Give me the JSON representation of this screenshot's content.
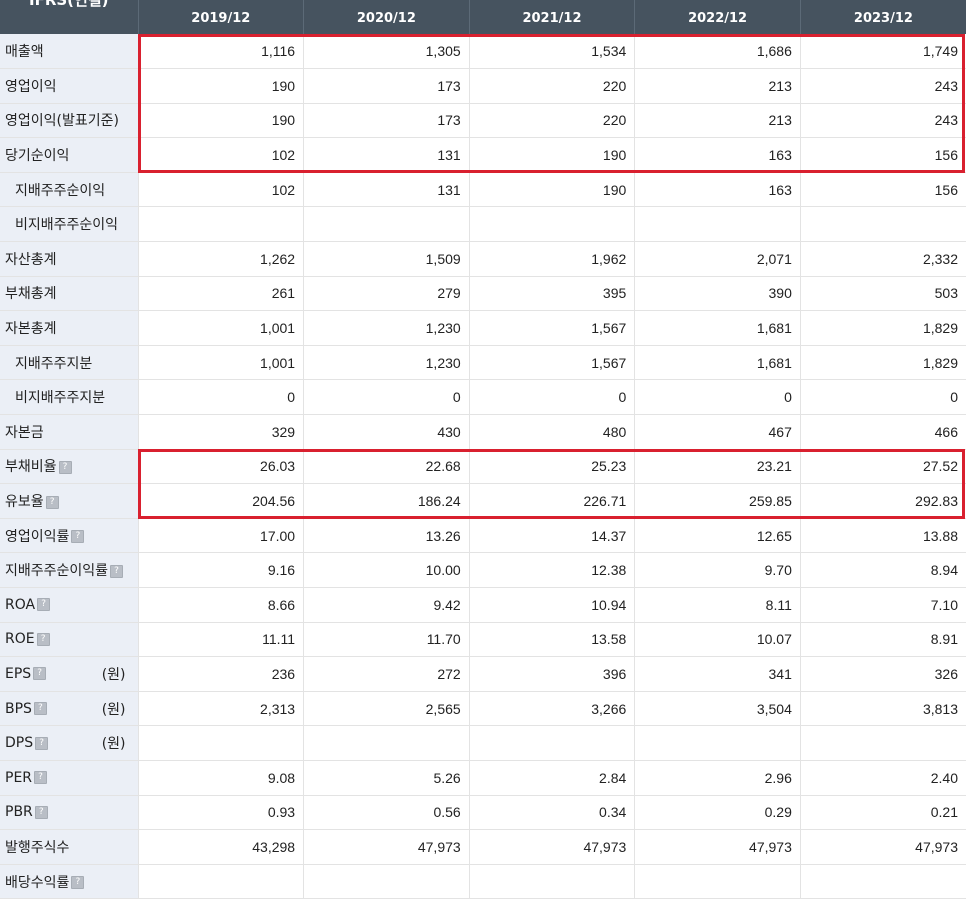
{
  "table": {
    "corner_label": "IFRS(연결)",
    "columns": [
      "2019/12",
      "2020/12",
      "2021/12",
      "2022/12",
      "2023/12"
    ],
    "rows": [
      {
        "label": "매출액",
        "values": [
          "1,116",
          "1,305",
          "1,534",
          "1,686",
          "1,749"
        ]
      },
      {
        "label": "영업이익",
        "values": [
          "190",
          "173",
          "220",
          "213",
          "243"
        ]
      },
      {
        "label": "영업이익(발표기준)",
        "values": [
          "190",
          "173",
          "220",
          "213",
          "243"
        ]
      },
      {
        "label": "당기순이익",
        "values": [
          "102",
          "131",
          "190",
          "163",
          "156"
        ]
      },
      {
        "label": "지배주주순이익",
        "sub": true,
        "values": [
          "102",
          "131",
          "190",
          "163",
          "156"
        ]
      },
      {
        "label": "비지배주주순이익",
        "sub": true,
        "values": [
          "",
          "",
          "",
          "",
          ""
        ]
      },
      {
        "label": "자산총계",
        "values": [
          "1,262",
          "1,509",
          "1,962",
          "2,071",
          "2,332"
        ]
      },
      {
        "label": "부채총계",
        "values": [
          "261",
          "279",
          "395",
          "390",
          "503"
        ]
      },
      {
        "label": "자본총계",
        "values": [
          "1,001",
          "1,230",
          "1,567",
          "1,681",
          "1,829"
        ]
      },
      {
        "label": "지배주주지분",
        "sub": true,
        "values": [
          "1,001",
          "1,230",
          "1,567",
          "1,681",
          "1,829"
        ]
      },
      {
        "label": "비지배주주지분",
        "sub": true,
        "values": [
          "0",
          "0",
          "0",
          "0",
          "0"
        ]
      },
      {
        "label": "자본금",
        "values": [
          "329",
          "430",
          "480",
          "467",
          "466"
        ]
      },
      {
        "label": "부채비율",
        "help": true,
        "values": [
          "26.03",
          "22.68",
          "25.23",
          "23.21",
          "27.52"
        ]
      },
      {
        "label": "유보율",
        "help": true,
        "values": [
          "204.56",
          "186.24",
          "226.71",
          "259.85",
          "292.83"
        ]
      },
      {
        "label": "영업이익률",
        "help": true,
        "values": [
          "17.00",
          "13.26",
          "14.37",
          "12.65",
          "13.88"
        ]
      },
      {
        "label": "지배주주순이익률",
        "help": true,
        "values": [
          "9.16",
          "10.00",
          "12.38",
          "9.70",
          "8.94"
        ]
      },
      {
        "label": "ROA",
        "help": true,
        "values": [
          "8.66",
          "9.42",
          "10.94",
          "8.11",
          "7.10"
        ]
      },
      {
        "label": "ROE",
        "help": true,
        "values": [
          "11.11",
          "11.70",
          "13.58",
          "10.07",
          "8.91"
        ]
      },
      {
        "label": "EPS",
        "help": true,
        "unit": "(원)",
        "values": [
          "236",
          "272",
          "396",
          "341",
          "326"
        ]
      },
      {
        "label": "BPS",
        "help": true,
        "unit": "(원)",
        "values": [
          "2,313",
          "2,565",
          "3,266",
          "3,504",
          "3,813"
        ]
      },
      {
        "label": "DPS",
        "help": true,
        "unit": "(원)",
        "values": [
          "",
          "",
          "",
          "",
          ""
        ]
      },
      {
        "label": "PER",
        "help": true,
        "values": [
          "9.08",
          "5.26",
          "2.84",
          "2.96",
          "2.40"
        ]
      },
      {
        "label": "PBR",
        "help": true,
        "values": [
          "0.93",
          "0.56",
          "0.34",
          "0.29",
          "0.21"
        ]
      },
      {
        "label": "발행주식수",
        "values": [
          "43,298",
          "47,973",
          "47,973",
          "47,973",
          "47,973"
        ]
      },
      {
        "label": "배당수익률",
        "help": true,
        "values": [
          "",
          "",
          "",
          "",
          ""
        ]
      }
    ]
  },
  "icons": {
    "help": "help-icon"
  },
  "colors": {
    "header_bg": "#46535f",
    "label_bg": "#ebeff6",
    "highlight": "#d9202f"
  }
}
